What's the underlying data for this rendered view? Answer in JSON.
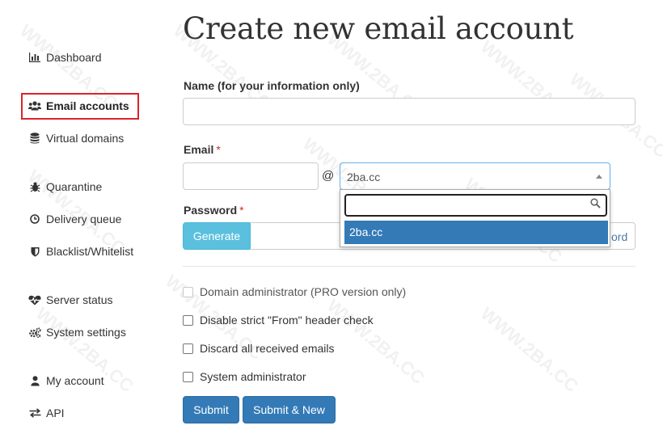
{
  "sidebar": {
    "items": [
      {
        "label": "Dashboard",
        "icon": "bar-chart-icon"
      },
      {
        "label": "Email accounts",
        "icon": "users-icon"
      },
      {
        "label": "Virtual domains",
        "icon": "database-icon"
      },
      {
        "label": "Quarantine",
        "icon": "bug-icon"
      },
      {
        "label": "Delivery queue",
        "icon": "clock-icon"
      },
      {
        "label": "Blacklist/Whitelist",
        "icon": "shield-icon"
      },
      {
        "label": "Server status",
        "icon": "heartbeat-icon"
      },
      {
        "label": "System settings",
        "icon": "cogs-icon"
      },
      {
        "label": "My account",
        "icon": "user-icon"
      },
      {
        "label": "API",
        "icon": "exchange-icon"
      }
    ],
    "active_item": "Email accounts",
    "active_color": "#d9252a"
  },
  "page": {
    "title": "Create new email account"
  },
  "form": {
    "name_label": "Name (for your information only)",
    "name_value": "",
    "email_label": "Email",
    "required_mark": "*",
    "email_local_value": "",
    "at_sign": "@",
    "domain_select": {
      "selected": "2ba.cc",
      "options": [
        "2ba.cc"
      ],
      "search_value": ""
    },
    "password_label": "Password",
    "generate_label": "Generate",
    "password_partial_text": "ord",
    "checkboxes": [
      {
        "label": "Domain administrator (PRO version only)",
        "checked": false,
        "disabled": true
      },
      {
        "label": "Disable strict \"From\" header check",
        "checked": false,
        "disabled": false
      },
      {
        "label": "Discard all received emails",
        "checked": false,
        "disabled": false
      },
      {
        "label": "System administrator",
        "checked": false,
        "disabled": false
      }
    ],
    "submit_label": "Submit",
    "submit_new_label": "Submit & New"
  },
  "watermark": {
    "text": "WWW.2BA.CC"
  },
  "colors": {
    "primary": "#337ab7",
    "info": "#5bc0de",
    "focus_border": "#66afe9"
  }
}
